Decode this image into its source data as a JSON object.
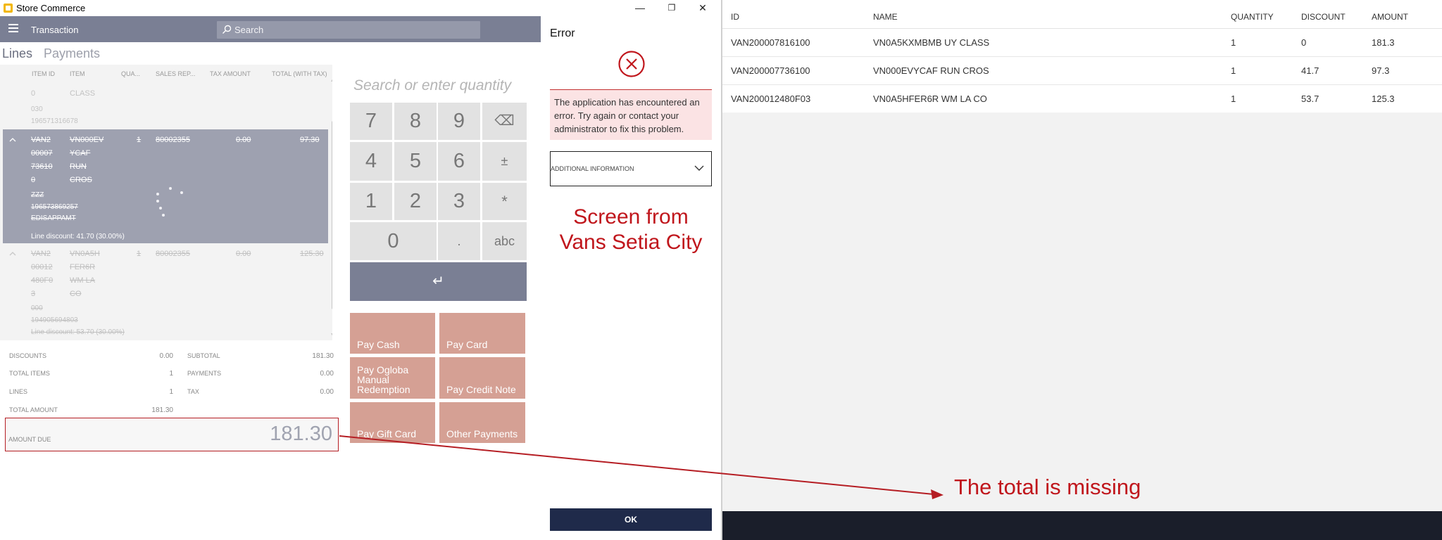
{
  "window": {
    "title": "Store Commerce",
    "minimize": "—",
    "restore": "❐",
    "close": "✕"
  },
  "topbar": {
    "nav_title": "Transaction",
    "search_placeholder": "Search"
  },
  "tabs": [
    "Lines",
    "Payments"
  ],
  "grid": {
    "headers": [
      "ITEM ID",
      "ITEM",
      "QUA...",
      "SALES REP...",
      "TAX AMOUNT",
      "TOTAL (WITH TAX)"
    ],
    "rows": [
      {
        "item_id": "0",
        "item": "CLASS",
        "line_a": "030",
        "line_b": "196571316678"
      },
      {
        "item_id": "VAN2\n00007\n73610\n0",
        "item": "VN000EV\nYCAF\nRUN\nCROS",
        "qty": "1",
        "sales_rep": "80002355",
        "tax": "0.00",
        "total": "97.30",
        "line_a": "ZZZ",
        "line_b": "196573869257",
        "line_c": "EDISAPPAMT",
        "discount": "Line discount: 41.70 (30.00%)"
      },
      {
        "item_id": "VAN2\n00012\n480F0\n3",
        "item": "VN0A5H\nFER6R\nWM LA\nCO",
        "qty": "1",
        "sales_rep": "80002355",
        "tax": "0.00",
        "total": "125.30",
        "line_a": "000",
        "line_b": "194905694803",
        "discount": "Line discount: 53.70 (30.00%)"
      }
    ]
  },
  "totals": {
    "discounts_label": "DISCOUNTS",
    "discounts_value": "0.00",
    "total_items_label": "TOTAL ITEMS",
    "total_items_value": "1",
    "lines_label": "LINES",
    "lines_value": "1",
    "total_amount_label": "TOTAL AMOUNT",
    "total_amount_value": "181.30",
    "subtotal_label": "SUBTOTAL",
    "subtotal_value": "181.30",
    "payments_label": "PAYMENTS",
    "payments_value": "0.00",
    "tax_label": "TAX",
    "tax_value": "0.00",
    "amount_due_label": "AMOUNT DUE",
    "amount_due_value": "181.30"
  },
  "numpad": {
    "placeholder": "Search or enter quantity",
    "keys": [
      "7",
      "8",
      "9",
      "⌫",
      "4",
      "5",
      "6",
      "±",
      "1",
      "2",
      "3",
      "*",
      "0",
      ".",
      "abc"
    ],
    "enter": "↵"
  },
  "payments": {
    "pay_cash": "Pay Cash",
    "pay_card": "Pay Card",
    "pay_ogloba": "Pay Ogloba\nManual\nRedemption",
    "pay_credit_note": "Pay Credit Note",
    "pay_gift_card": "Pay Gift Card",
    "other_payments": "Other Payments"
  },
  "error": {
    "title": "Error",
    "message": "The application has encountered an error. Try again or contact your administrator to fix this problem.",
    "additional_info": "ADDITIONAL INFORMATION",
    "ok": "OK"
  },
  "annotations": {
    "screen_from": "Screen from\nVans Setia City",
    "total_missing": "The total is missing"
  },
  "table": {
    "headers": [
      "ID",
      "NAME",
      "QUANTITY",
      "DISCOUNT",
      "AMOUNT"
    ],
    "rows": [
      [
        "VAN200007816100",
        "VN0A5KXMBMB UY CLASS",
        "1",
        "0",
        "181.3"
      ],
      [
        "VAN200007736100",
        "VN000EVYCAF RUN CROS",
        "1",
        "41.7",
        "97.3"
      ],
      [
        "VAN200012480F03",
        "VN0A5HFER6R WM LA CO",
        "1",
        "53.7",
        "125.3"
      ]
    ]
  },
  "colors": {
    "topbar": "#7a7f94",
    "accent_red": "#c0161c",
    "pay_button": "#d5a094",
    "ok_button": "#1f2a4a"
  }
}
